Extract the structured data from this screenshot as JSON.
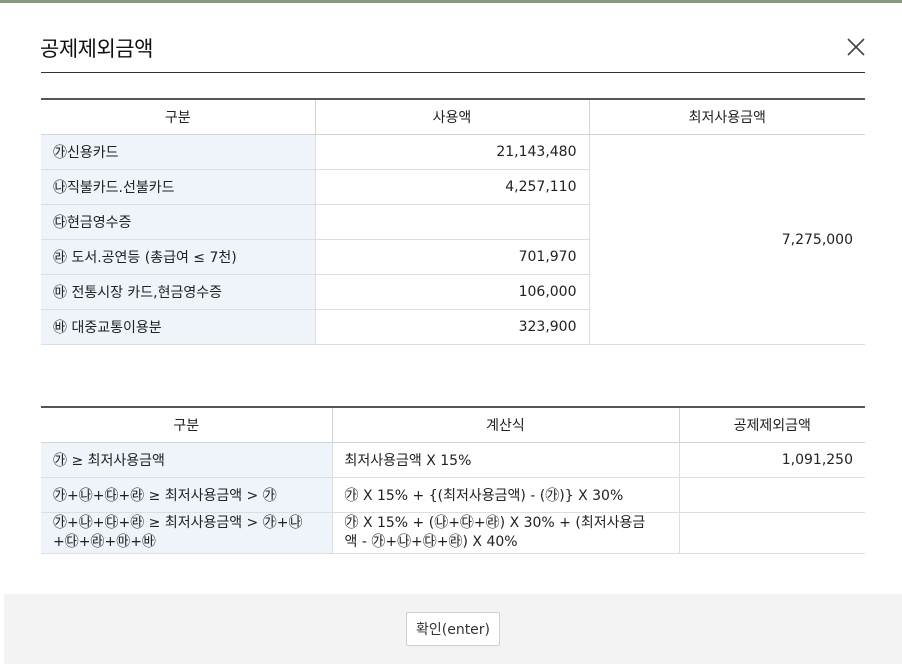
{
  "dialog": {
    "title": "공제제외금액",
    "close_icon": "close-icon"
  },
  "table1": {
    "headers": [
      "구분",
      "사용액",
      "최저사용금액"
    ],
    "rows": [
      {
        "label": "㉮신용카드",
        "amount": "21,143,480"
      },
      {
        "label": "㉯직불카드.선불카드",
        "amount": "4,257,110"
      },
      {
        "label": "㉰현금영수증",
        "amount": ""
      },
      {
        "label": "㉱ 도서.공연등 (총급여 ≤ 7천)",
        "amount": "701,970"
      },
      {
        "label": "㉲ 전통시장 카드,현금영수증",
        "amount": "106,000"
      },
      {
        "label": "㉳ 대중교통이용분",
        "amount": "323,900"
      }
    ],
    "minimum_amount": "7,275,000"
  },
  "table2": {
    "headers": [
      "구분",
      "계산식",
      "공제제외금액"
    ],
    "rows": [
      {
        "label": "㉮ ≥ 최저사용금액",
        "formula": "최저사용금액 X 15%",
        "amount": "1,091,250"
      },
      {
        "label": "㉮+㉯+㉰+㉱ ≥ 최저사용금액 > ㉮",
        "formula": "㉮ X 15% + {(최저사용금액) - (㉮)} X 30%",
        "amount": ""
      },
      {
        "label_line1": "㉮+㉯+㉰+㉱ ≥ 최저사용금액 > ㉮+㉯",
        "label_line2": "+㉰+㉱+㉲+㉳",
        "formula_line1": "㉮ X 15% + (㉯+㉰+㉱) X 30% + (최저사용금",
        "formula_line2": "액 - ㉮+㉯+㉰+㉱) X 40%",
        "amount": ""
      }
    ]
  },
  "footer": {
    "ok_label": "확인(enter)"
  }
}
